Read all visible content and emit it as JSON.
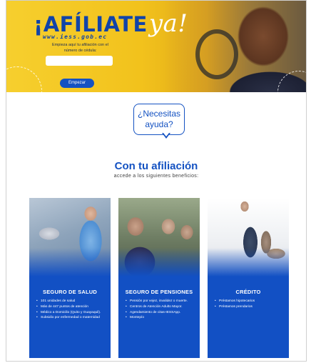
{
  "hero": {
    "brand_main": "¡AFÍLIATE",
    "brand_ya": "ya!",
    "url": "www.iess.gob.ec",
    "hint": "Empieza aquí tu afiliación con el número de cédula:",
    "input_value": "",
    "button_label": "Empezar",
    "accent_color": "#1452c2",
    "background_color": "#f6cf2e"
  },
  "help": {
    "bubble_text": "¿Necesitas ayuda?"
  },
  "benefits": {
    "title": "Con tu afiliación",
    "subtitle": "accede a los siguientes beneficios:",
    "cards": [
      {
        "title": "SEGURO DE SALUD",
        "items": [
          "101 unidades de salud",
          "Más de 447 puntos de atención",
          "Médico a Domicilio (Quito y Guayaquil).",
          "Subsidio por enfermedad o maternidad"
        ]
      },
      {
        "title": "SEGURO DE PENSIONES",
        "items": [
          "Pensión por vejez, invalidez o muerte.",
          "Centros de Atención Adulto Mayor.",
          "Agendamiento de citas-IESSApp.",
          "Montepío"
        ]
      },
      {
        "title": "CRÉDITO",
        "items": [
          "Préstamos hipotecarios",
          "Préstamos prendarios"
        ]
      }
    ],
    "card_color": "#1250c4"
  }
}
